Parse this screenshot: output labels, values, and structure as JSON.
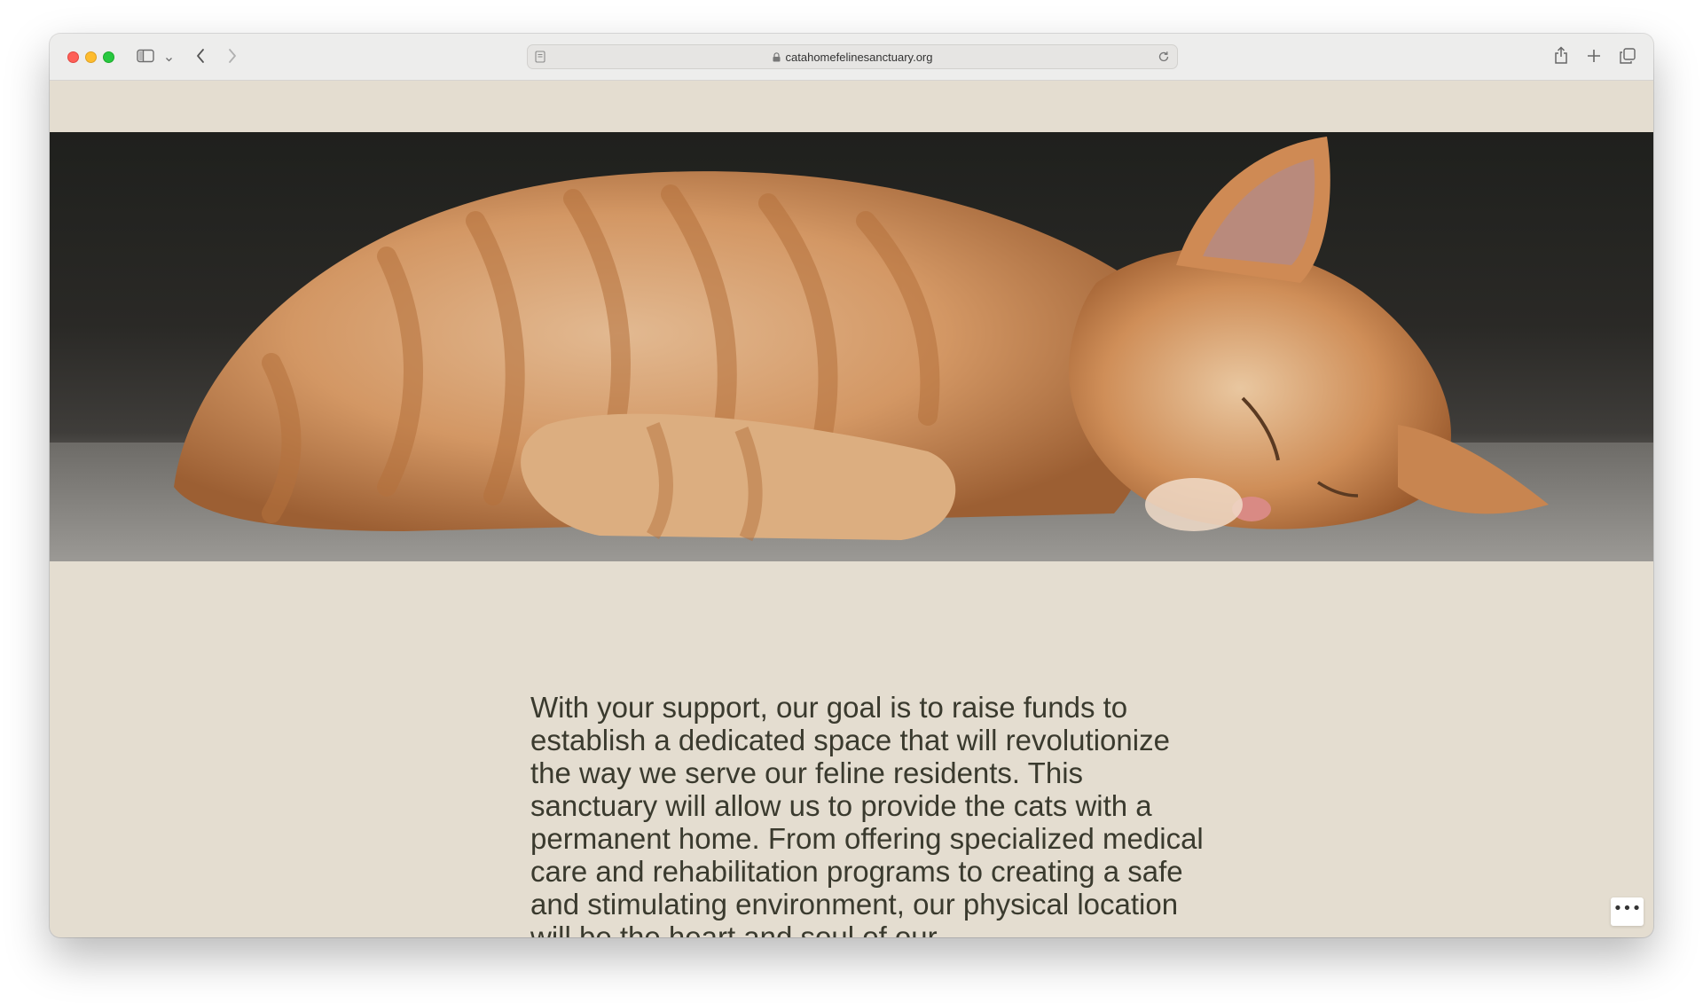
{
  "browser": {
    "url": "catahomefelinesanctuary.org",
    "icons": {
      "close": "close-dot",
      "minimize": "minimize-dot",
      "zoom": "zoom-dot",
      "sidebar": "sidebar-icon",
      "sidebar_menu": "chevron-down-icon",
      "back": "back-arrow-icon",
      "forward": "forward-arrow-icon",
      "reader": "reader-icon",
      "lock": "lock-icon",
      "reload": "reload-icon",
      "share": "share-icon",
      "new_tab": "plus-icon",
      "tabs": "tabs-overview-icon"
    }
  },
  "page": {
    "hero_image": "sleeping orange tabby kitten photo",
    "body_text": "With your support, our goal is to raise funds to establish a dedicated space that will revolutionize the way we serve our feline residents. This sanctuary will allow us to provide the cats with a permanent home. From offering specialized medical care and rehabilitation programs to creating a safe and stimulating environment, our physical location will be the heart and soul of our",
    "more_button": "•••"
  },
  "colors": {
    "page_background": "#e4ddd0",
    "text": "#3a3a2e",
    "toolbar": "#ededec"
  }
}
